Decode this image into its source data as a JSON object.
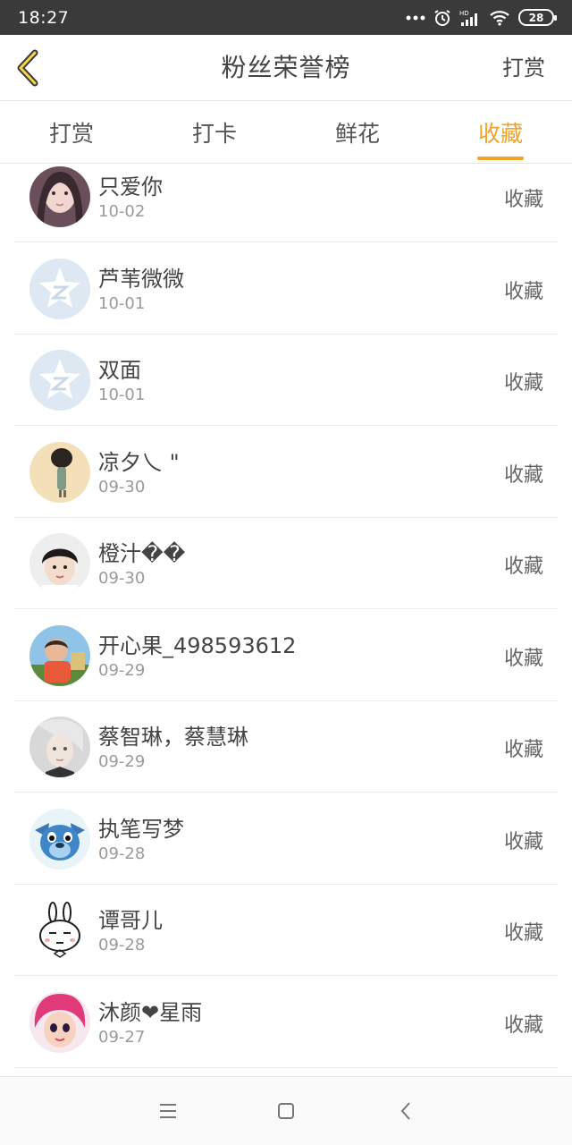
{
  "status_bar": {
    "time": "18:27",
    "battery": "28",
    "icons": [
      "more-dots-icon",
      "alarm-icon",
      "signal-icon",
      "wifi-icon",
      "battery-icon"
    ]
  },
  "header": {
    "title": "粉丝荣誉榜",
    "action_label": "打赏",
    "back_icon": "back-chevron-icon"
  },
  "tabs": [
    {
      "label": "打赏",
      "active": false
    },
    {
      "label": "打卡",
      "active": false
    },
    {
      "label": "鲜花",
      "active": false
    },
    {
      "label": "收藏",
      "active": true
    }
  ],
  "colors": {
    "accent": "#f0a326",
    "text": "#444444",
    "subtext": "#9a9a9a",
    "status_bar": "#3a3a3a"
  },
  "items": [
    {
      "name": "只爱你",
      "date": "10-02",
      "tag": "收藏",
      "avatar": "girl-photo"
    },
    {
      "name": "芦苇微微",
      "date": "10-01",
      "tag": "收藏",
      "avatar": "default-star"
    },
    {
      "name": "双面",
      "date": "10-01",
      "tag": "收藏",
      "avatar": "default-star"
    },
    {
      "name": "凉夕乀 \"",
      "date": "09-30",
      "tag": "收藏",
      "avatar": "figure-photo"
    },
    {
      "name": "橙汁��",
      "date": "09-30",
      "tag": "收藏",
      "avatar": "boy-photo"
    },
    {
      "name": "开心果_498593612",
      "date": "09-29",
      "tag": "收藏",
      "avatar": "kid-photo"
    },
    {
      "name": "蔡智琳，蔡慧琳",
      "date": "09-29",
      "tag": "收藏",
      "avatar": "portrait-photo"
    },
    {
      "name": "执笔写梦",
      "date": "09-28",
      "tag": "收藏",
      "avatar": "stitch-cartoon"
    },
    {
      "name": "谭哥儿",
      "date": "09-28",
      "tag": "收藏",
      "avatar": "bunny-cartoon"
    },
    {
      "name": "沐颜❤星雨",
      "date": "09-27",
      "tag": "收藏",
      "avatar": "pink-hair-cartoon"
    }
  ],
  "nav_bar": {
    "icons": [
      "menu-icon",
      "home-square-icon",
      "back-arrow-icon"
    ]
  }
}
